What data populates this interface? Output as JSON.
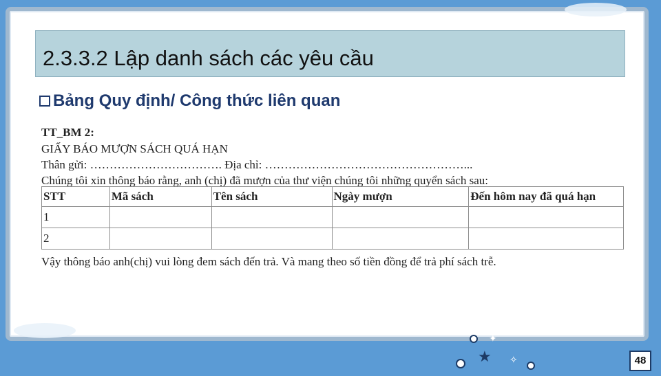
{
  "slide": {
    "title": "2.3.3.2 Lập danh sách các yêu cầu",
    "subtitle": "Bảng Quy định/ Công thức liên quan",
    "page_number": "48"
  },
  "form": {
    "code": "TT_BM 2:",
    "heading": "GIẤY BÁO MƯỢN SÁCH QUÁ HẠN",
    "recipient_line": "Thân gửi: ……………………………. Địa chỉ: ……………………………………………...",
    "message": "Chúng tôi xin thông báo rằng, anh (chị) đã mượn của thư viện chúng tôi những quyển sách sau:",
    "table": {
      "headers": [
        "STT",
        "Mã sách",
        "Tên sách",
        "Ngày mượn",
        "Đến hôm nay đã quá hạn"
      ],
      "rows": [
        [
          "1",
          "",
          "",
          "",
          ""
        ],
        [
          "2",
          "",
          "",
          "",
          ""
        ]
      ]
    },
    "footer": "Vậy thông báo anh(chị) vui lòng đem sách đến trả. Và mang theo số tiền           đồng để trả phí sách trễ."
  }
}
